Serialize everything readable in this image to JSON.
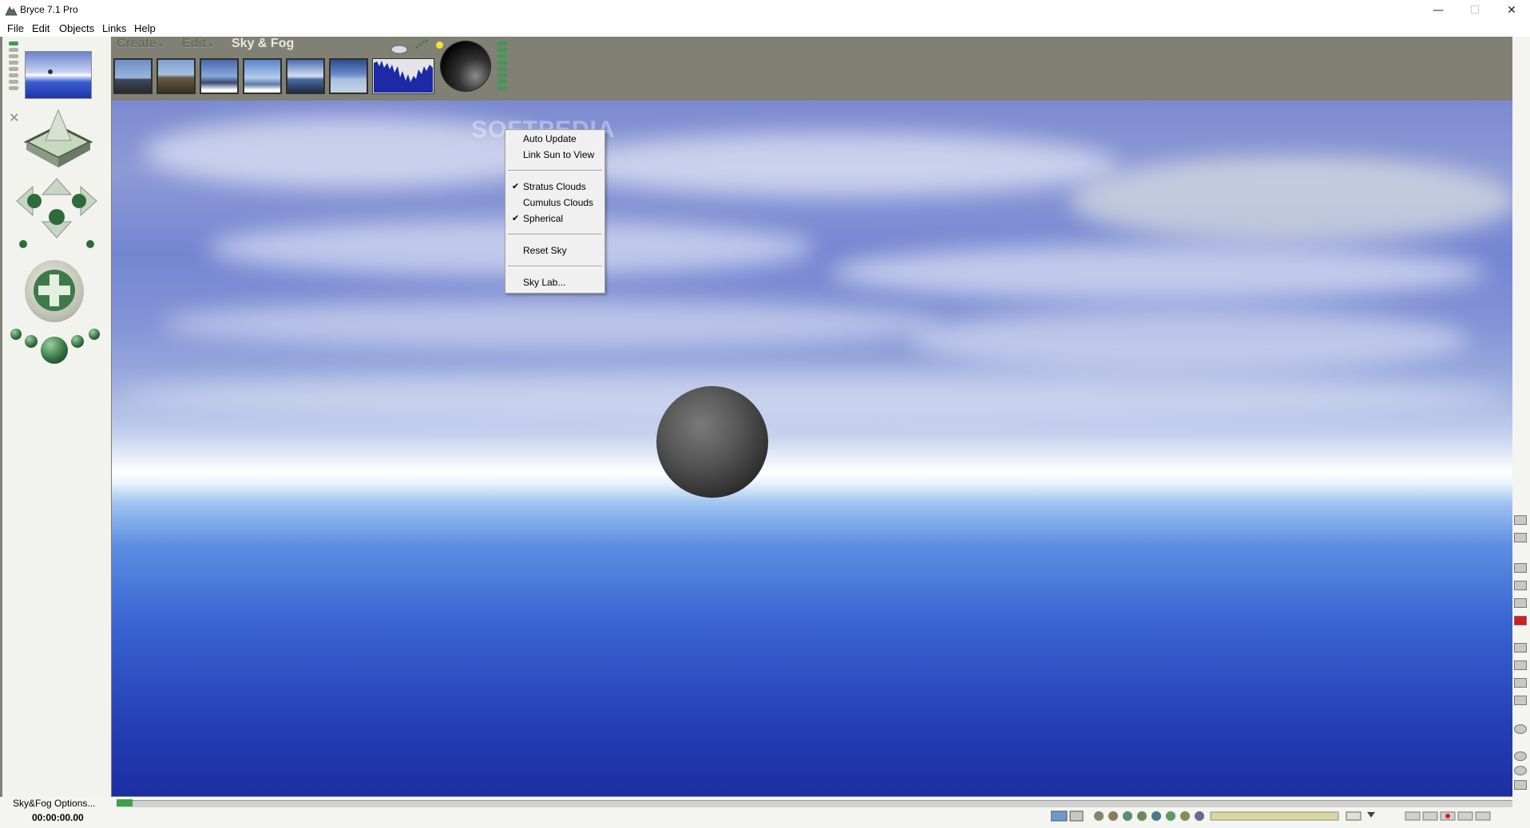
{
  "window": {
    "title": "Bryce 7.1 Pro",
    "buttons": {
      "minimize": "—",
      "maximize": "☐",
      "close": "✕"
    }
  },
  "menubar": {
    "items": [
      "File",
      "Edit",
      "Objects",
      "Links",
      "Help"
    ]
  },
  "palette_tabs": [
    {
      "label": "Create",
      "state": "inactive"
    },
    {
      "label": "Edit",
      "state": "inactive"
    },
    {
      "label": "Sky & Fog",
      "state": "active"
    }
  ],
  "sky_presets": {
    "count": 6
  },
  "context_menu": {
    "items": [
      {
        "label": "Auto Update",
        "checked": false
      },
      {
        "label": "Link Sun to View",
        "checked": false
      },
      {
        "separator": true
      },
      {
        "label": "Stratus Clouds",
        "checked": true
      },
      {
        "label": "Cumulus Clouds",
        "checked": false
      },
      {
        "label": "Spherical",
        "checked": true
      },
      {
        "separator": true
      },
      {
        "label": "Reset Sky",
        "checked": false
      },
      {
        "separator": true
      },
      {
        "label": "Sky Lab...",
        "checked": false
      }
    ],
    "check_glyph": "✔"
  },
  "watermark": "SOFTPEDIA",
  "status": {
    "label": "Sky&Fog Options...",
    "time": "00:00:00.00"
  },
  "colors": {
    "panel": "#808074",
    "accent_green": "#3e9a52",
    "sun": "#f4e23a"
  }
}
